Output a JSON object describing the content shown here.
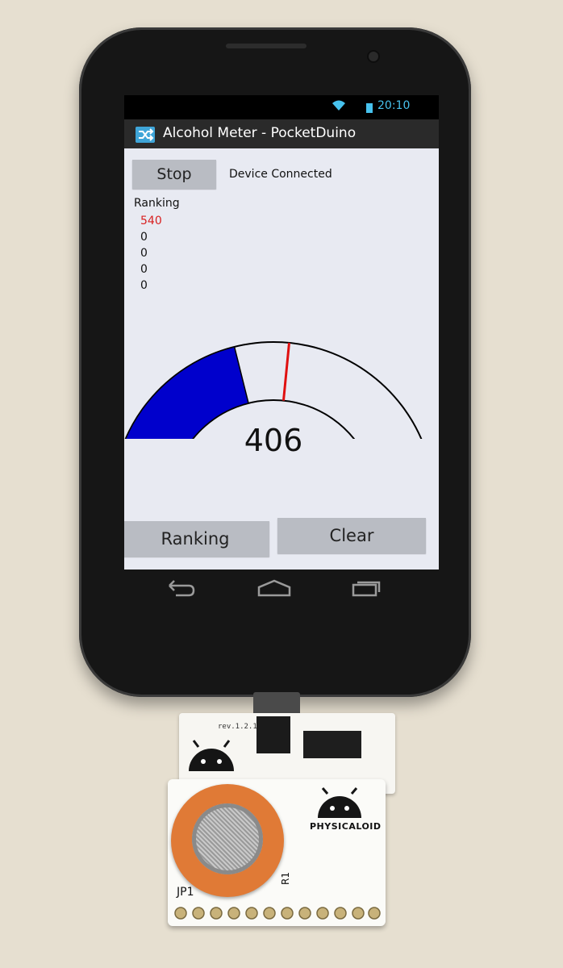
{
  "status_bar": {
    "time": "20:10"
  },
  "app": {
    "title": "Alcohol Meter - PocketDuino"
  },
  "controls": {
    "stop_label": "Stop",
    "connection_status": "Device Connected",
    "ranking_label": "Ranking",
    "clear_label": "Clear"
  },
  "ranking": {
    "title": "Ranking",
    "entries": [
      "540",
      "0",
      "0",
      "0",
      "0"
    ]
  },
  "gauge": {
    "reading": "406",
    "fill_fraction": 0.4,
    "marker_fraction": 0.54
  },
  "colors": {
    "accent": "#47c2ee",
    "gauge_fill": "#0000cc",
    "marker": "#e01010",
    "top_rank": "#d82020"
  },
  "icons": [
    "wifi-icon",
    "battery-icon",
    "shuffle-icon",
    "back-icon",
    "home-icon",
    "recent-apps-icon"
  ],
  "hardware": {
    "revision": "rev.1.2.1",
    "brand": "PHYSICALOID",
    "header_label": "JP1",
    "resistor_label": "R1"
  }
}
